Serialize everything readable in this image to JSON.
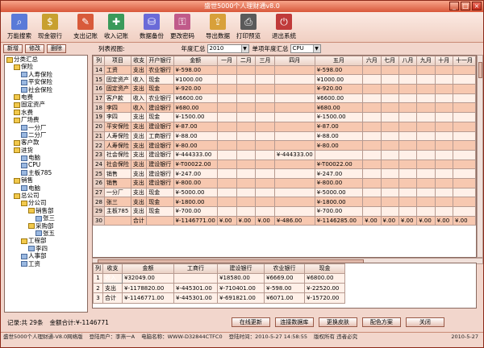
{
  "window": {
    "title": "盛世5000个人理财通v8.0"
  },
  "toolbar": [
    {
      "label": "万能搜索",
      "icon": "search-icon",
      "color": "#5a7ad8"
    },
    {
      "label": "现金银行",
      "icon": "bank-icon",
      "color": "#c8a030"
    },
    {
      "label": "支出记账",
      "icon": "expense-icon",
      "color": "#d85a3a"
    },
    {
      "label": "收入记账",
      "icon": "income-icon",
      "color": "#3a9a5a"
    },
    {
      "label": "数据备份",
      "icon": "backup-icon",
      "color": "#6a6ad8"
    },
    {
      "label": "更改密码",
      "icon": "password-icon",
      "color": "#c05a8a"
    },
    {
      "label": "导出数据",
      "icon": "export-icon",
      "color": "#d8a03a"
    },
    {
      "label": "打印预览",
      "icon": "printer-icon",
      "color": "#5a5a5a"
    },
    {
      "label": "退出系统",
      "icon": "exit-icon",
      "color": "#c03a3a"
    }
  ],
  "filter": {
    "add": "新增",
    "edit": "修改",
    "delete": "删除",
    "view_label": "列表视图:",
    "year_label": "年度汇总",
    "year_value": "2010",
    "item_label": "单项年度汇总",
    "item_value": "CPU"
  },
  "tree": [
    {
      "label": "分类汇总",
      "level": 0,
      "leaf": false
    },
    {
      "label": "保险",
      "level": 1,
      "leaf": false
    },
    {
      "label": "人寿保险",
      "level": 2,
      "leaf": true
    },
    {
      "label": "平安保险",
      "level": 2,
      "leaf": true
    },
    {
      "label": "社会保险",
      "level": 2,
      "leaf": true
    },
    {
      "label": "电费",
      "level": 1,
      "leaf": false
    },
    {
      "label": "固定资产",
      "level": 1,
      "leaf": false
    },
    {
      "label": "水费",
      "level": 1,
      "leaf": false
    },
    {
      "label": "厂场费",
      "level": 1,
      "leaf": false
    },
    {
      "label": "一分厂",
      "level": 2,
      "leaf": true
    },
    {
      "label": "二分厂",
      "level": 2,
      "leaf": true
    },
    {
      "label": "客户款",
      "level": 1,
      "leaf": false
    },
    {
      "label": "进货",
      "level": 1,
      "leaf": false
    },
    {
      "label": "电脑",
      "level": 2,
      "leaf": true
    },
    {
      "label": "CPU",
      "level": 2,
      "leaf": true
    },
    {
      "label": "主板785",
      "level": 2,
      "leaf": true
    },
    {
      "label": "销售",
      "level": 1,
      "leaf": false
    },
    {
      "label": "电脑",
      "level": 2,
      "leaf": true
    },
    {
      "label": "总公司",
      "level": 1,
      "leaf": false
    },
    {
      "label": "分公司",
      "level": 2,
      "leaf": false
    },
    {
      "label": "销售部",
      "level": 3,
      "leaf": false
    },
    {
      "label": "张三",
      "level": 4,
      "leaf": true
    },
    {
      "label": "采购部",
      "level": 3,
      "leaf": false
    },
    {
      "label": "张五",
      "level": 4,
      "leaf": true
    },
    {
      "label": "工程部",
      "level": 2,
      "leaf": false
    },
    {
      "label": "李四",
      "level": 3,
      "leaf": true
    },
    {
      "label": "人事部",
      "level": 2,
      "leaf": true
    },
    {
      "label": "工资",
      "level": 2,
      "leaf": true
    }
  ],
  "main_table": {
    "headers": [
      "列",
      "项目",
      "收支",
      "开户银行",
      "金额",
      "一月",
      "二月",
      "三月",
      "四月",
      "五月",
      "六月",
      "七月",
      "八月",
      "九月",
      "十月",
      "十一月"
    ],
    "rows": [
      [
        "14",
        "工资",
        "支出",
        "农业银行",
        "¥-598.00",
        "",
        "",
        "",
        "",
        "¥-598.00",
        "",
        "",
        "",
        "",
        "",
        ""
      ],
      [
        "15",
        "固定资产",
        "收入",
        "现金",
        "¥1000.00",
        "",
        "",
        "",
        "",
        "¥1000.00",
        "",
        "",
        "",
        "",
        "",
        ""
      ],
      [
        "16",
        "固定资产",
        "支出",
        "现金",
        "¥-920.00",
        "",
        "",
        "",
        "",
        "¥-920.00",
        "",
        "",
        "",
        "",
        "",
        ""
      ],
      [
        "17",
        "客户款",
        "收入",
        "农业银行",
        "¥6600.00",
        "",
        "",
        "",
        "",
        "¥6600.00",
        "",
        "",
        "",
        "",
        "",
        ""
      ],
      [
        "18",
        "李四",
        "收入",
        "建设银行",
        "¥680.00",
        "",
        "",
        "",
        "",
        "¥680.00",
        "",
        "",
        "",
        "",
        "",
        ""
      ],
      [
        "19",
        "李四",
        "支出",
        "现金",
        "¥-1500.00",
        "",
        "",
        "",
        "",
        "¥-1500.00",
        "",
        "",
        "",
        "",
        "",
        ""
      ],
      [
        "20",
        "平安保险",
        "支出",
        "建设银行",
        "¥-87.00",
        "",
        "",
        "",
        "",
        "¥-87.00",
        "",
        "",
        "",
        "",
        "",
        ""
      ],
      [
        "21",
        "人寿保险",
        "支出",
        "工商银行",
        "¥-88.00",
        "",
        "",
        "",
        "",
        "¥-88.00",
        "",
        "",
        "",
        "",
        "",
        ""
      ],
      [
        "22",
        "人寿保险",
        "支出",
        "建设银行",
        "¥-80.00",
        "",
        "",
        "",
        "",
        "¥-80.00",
        "",
        "",
        "",
        "",
        "",
        ""
      ],
      [
        "23",
        "社会保险",
        "支出",
        "建设银行",
        "¥-444333.00",
        "",
        "",
        "",
        "¥-444333.00",
        "",
        "",
        "",
        "",
        "",
        "",
        ""
      ],
      [
        "24",
        "社会保险",
        "支出",
        "建设银行",
        "¥-T00022.00",
        "",
        "",
        "",
        "",
        "¥-T00022.00",
        "",
        "",
        "",
        "",
        "",
        ""
      ],
      [
        "25",
        "销售",
        "支出",
        "建设银行",
        "¥-247.00",
        "",
        "",
        "",
        "",
        "¥-247.00",
        "",
        "",
        "",
        "",
        "",
        ""
      ],
      [
        "26",
        "销售",
        "支出",
        "建设银行",
        "¥-800.00",
        "",
        "",
        "",
        "",
        "¥-800.00",
        "",
        "",
        "",
        "",
        "",
        ""
      ],
      [
        "27",
        "一分厂",
        "支出",
        "现金",
        "¥-5000.00",
        "",
        "",
        "",
        "",
        "¥-5000.00",
        "",
        "",
        "",
        "",
        "",
        ""
      ],
      [
        "28",
        "张三",
        "支出",
        "现金",
        "¥-1800.00",
        "",
        "",
        "",
        "",
        "¥-1800.00",
        "",
        "",
        "",
        "",
        "",
        ""
      ],
      [
        "29",
        "主板785",
        "支出",
        "现金",
        "¥-700.00",
        "",
        "",
        "",
        "",
        "¥-700.00",
        "",
        "",
        "",
        "",
        "",
        ""
      ],
      [
        "30",
        "",
        "合计",
        "",
        "¥-1146771.00",
        "¥.00",
        "¥.00",
        "¥.00",
        "¥-486.00",
        "¥-1146285.00",
        "¥.00",
        "¥.00",
        "¥.00",
        "¥.00",
        "¥.00",
        "¥.00"
      ]
    ]
  },
  "summary_table": {
    "headers": [
      "列",
      "收支",
      "金额",
      "工商行",
      "建设银行",
      "农业银行",
      "现金"
    ],
    "rows": [
      [
        "1",
        "收入",
        "¥32049.00",
        "",
        "¥18580.00",
        "¥6669.00",
        "¥6800.00"
      ],
      [
        "2",
        "支出",
        "¥-1178820.00",
        "¥-445301.00",
        "¥-710401.00",
        "¥-598.00",
        "¥-22520.00"
      ],
      [
        "3",
        "合计",
        "¥-1146771.00",
        "¥-445301.00",
        "¥-691821.00",
        "¥6071.00",
        "¥-15720.00"
      ]
    ]
  },
  "status": {
    "records": "记录:共 29条",
    "total": "金额合计:¥-1146771"
  },
  "buttons": {
    "update": "在线更新",
    "connect": "连接数据库",
    "skin": "更换皮肤",
    "theme": "配色方案",
    "close": "关闭"
  },
  "footer": {
    "app": "盛世5000个人理财通-V8.0网络版",
    "user": "登陆用户：李燕一A",
    "computer": "电脑名称：WWW-D32844CTFC0",
    "login_time": "登陆时间：2010-5-27 14:58:55",
    "copyright": "版权所有 违者必究",
    "date": "2010-5-27"
  }
}
